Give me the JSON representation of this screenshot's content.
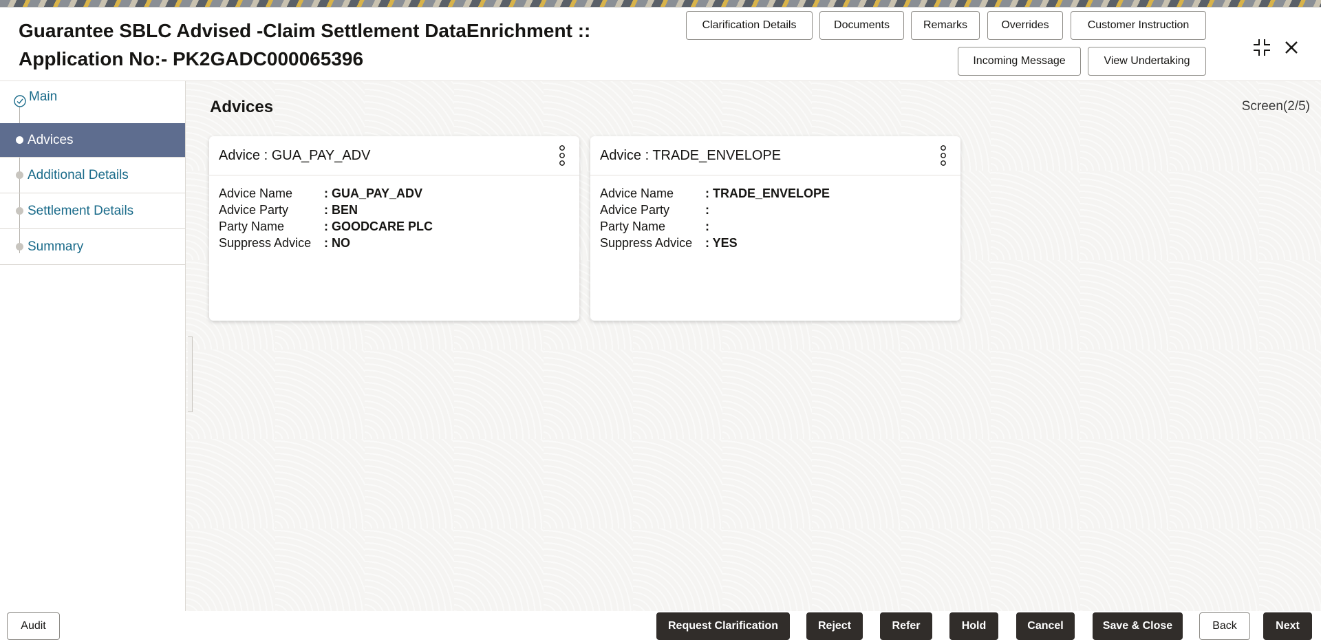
{
  "header": {
    "title_line1": "Guarantee SBLC Advised -Claim Settlement DataEnrichment ::",
    "title_line2": "Application No:- PK2GADC000065396",
    "buttons": {
      "clarification_details": "Clarification Details",
      "documents": "Documents",
      "remarks": "Remarks",
      "overrides": "Overrides",
      "customer_instruction": "Customer Instruction",
      "incoming_message": "Incoming Message",
      "view_undertaking": "View Undertaking"
    },
    "icons": {
      "minimize": "collapse-icon",
      "close": "close-icon"
    }
  },
  "sidebar": {
    "items": [
      {
        "label": "Main",
        "state": "completed"
      },
      {
        "label": "Advices",
        "state": "active"
      },
      {
        "label": "Additional Details",
        "state": "pending"
      },
      {
        "label": "Settlement Details",
        "state": "pending"
      },
      {
        "label": "Summary",
        "state": "pending"
      }
    ]
  },
  "main": {
    "title": "Advices",
    "screen_indicator": "Screen(2/5)",
    "cards": [
      {
        "heading": "Advice : GUA_PAY_ADV",
        "rows": [
          {
            "label": "Advice Name",
            "value": ": GUA_PAY_ADV"
          },
          {
            "label": "Advice Party",
            "value": ": BEN"
          },
          {
            "label": "Party Name",
            "value": ": GOODCARE PLC"
          },
          {
            "label": "Suppress Advice",
            "value": ": NO"
          }
        ]
      },
      {
        "heading": "Advice : TRADE_ENVELOPE",
        "rows": [
          {
            "label": "Advice Name",
            "value": ": TRADE_ENVELOPE"
          },
          {
            "label": "Advice Party",
            "value": ":"
          },
          {
            "label": "Party Name",
            "value": ":"
          },
          {
            "label": "Suppress Advice",
            "value": ": YES"
          }
        ]
      }
    ]
  },
  "footer": {
    "audit": "Audit",
    "request_clarification": "Request Clarification",
    "reject": "Reject",
    "refer": "Refer",
    "hold": "Hold",
    "cancel": "Cancel",
    "save_close": "Save & Close",
    "back": "Back",
    "next": "Next"
  },
  "colors": {
    "active_nav": "#5e6d8f",
    "link": "#1a6b8a",
    "primary_button": "#312d2a"
  }
}
